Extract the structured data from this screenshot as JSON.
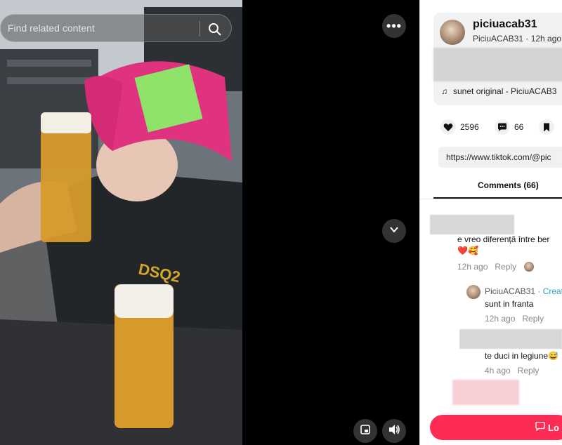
{
  "video": {
    "search_placeholder": "Find related content"
  },
  "author": {
    "username": "piciuacab31",
    "meta": "PiciuACAB31 · 12h ago",
    "sound": "sunet original - PiciuACAB3"
  },
  "stats": {
    "likes": "2596",
    "comments": "66"
  },
  "link": "https://www.tiktok.com/@pic",
  "comments_tab": "Comments (66)",
  "comments": [
    {
      "text": "e vreo diferență între ber",
      "emoji": "❤️🥰",
      "time": "12h ago",
      "reply": "Reply"
    },
    {
      "name": "PiciuACAB31",
      "tag": "Creat",
      "text": "sunt in franta",
      "time": "12h ago",
      "reply": "Reply"
    },
    {
      "text": "te duci in legiune😅",
      "time": "4h ago",
      "reply": "Reply"
    }
  ],
  "login_label": "Lo",
  "colors": {
    "accent": "#fe2c55",
    "creator_tag": "#2aa3c9"
  }
}
